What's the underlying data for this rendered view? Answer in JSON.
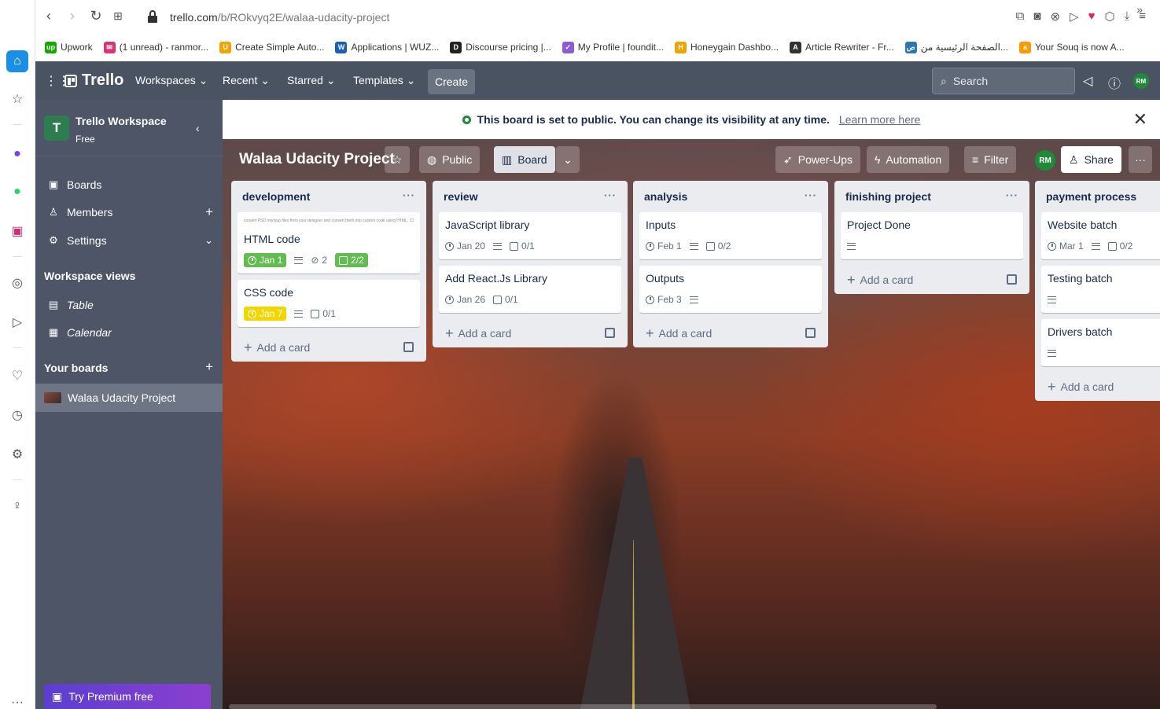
{
  "browser": {
    "url_host": "trello.com",
    "url_path": "/b/ROkvyq2E/walaa-udacity-project",
    "bookmarks": [
      {
        "label": "Upwork",
        "color": "#14a800",
        "glyph": "up"
      },
      {
        "label": "(1 unread) - ranmor...",
        "color": "#d93473",
        "glyph": "✉"
      },
      {
        "label": "Create Simple Auto...",
        "color": "#f0a400",
        "glyph": "U"
      },
      {
        "label": "Applications | WUZ...",
        "color": "#1a5fb4",
        "glyph": "W"
      },
      {
        "label": "Discourse pricing |...",
        "color": "#222222",
        "glyph": "D"
      },
      {
        "label": "My Profile | foundit...",
        "color": "#8a5cd6",
        "glyph": "✓"
      },
      {
        "label": "Honeygain Dashbo...",
        "color": "#f0a400",
        "glyph": "H"
      },
      {
        "label": "Article Rewriter - Fr...",
        "color": "#333333",
        "glyph": "A"
      },
      {
        "label": "الصفحة الرئيسية من...",
        "color": "#2a7ab0",
        "glyph": "ص"
      },
      {
        "label": "Your Souq is now A...",
        "color": "#ff9900",
        "glyph": "a"
      }
    ],
    "bookmarks_more": "»"
  },
  "header": {
    "logo": "Trello",
    "menus": [
      "Workspaces",
      "Recent",
      "Starred",
      "Templates"
    ],
    "create": "Create",
    "search_placeholder": "Search",
    "avatar": "RM"
  },
  "sidebar": {
    "workspace_initial": "T",
    "workspace_name": "Trello Workspace",
    "workspace_plan": "Free",
    "items": [
      {
        "label": "Boards",
        "icon": "board-icon"
      },
      {
        "label": "Members",
        "icon": "person-icon"
      },
      {
        "label": "Settings",
        "icon": "gear-icon"
      }
    ],
    "views_title": "Workspace views",
    "views": [
      {
        "label": "Table",
        "icon": "table-icon"
      },
      {
        "label": "Calendar",
        "icon": "calendar-icon"
      }
    ],
    "your_boards_title": "Your boards",
    "boards": [
      "Walaa Udacity Project"
    ],
    "premium": "Try Premium free"
  },
  "notice": {
    "text": "This board is set to public. You can change its visibility at any time.",
    "link": "Learn more here"
  },
  "board": {
    "title": "Walaa Udacity Project",
    "visibility": "Public",
    "view": "Board",
    "powerups": "Power-Ups",
    "automation": "Automation",
    "filter": "Filter",
    "member": "RM",
    "share": "Share"
  },
  "lists": [
    {
      "title": "development",
      "cards": [
        {
          "cover_text": "convert PSD mockup files from your designer and convert them into custom code using HTML, CSS, and JavaScript",
          "title": "HTML code",
          "due": "Jan 1",
          "due_style": "green",
          "desc": true,
          "attachments": "2",
          "checklist": "2/2",
          "checklist_style": "green"
        },
        {
          "title": "CSS code",
          "due": "Jan 7",
          "due_style": "yellow",
          "desc": true,
          "checklist": "0/1"
        }
      ],
      "add": "Add a card"
    },
    {
      "title": "review",
      "cards": [
        {
          "title": "JavaScript library",
          "due": "Jan 20",
          "desc": true,
          "checklist": "0/1"
        },
        {
          "title": "Add React.Js Library",
          "due": "Jan 26",
          "checklist": "0/1"
        }
      ],
      "add": "Add a card"
    },
    {
      "title": "analysis",
      "cards": [
        {
          "title": "Inputs",
          "due": "Feb 1",
          "desc": true,
          "checklist": "0/2"
        },
        {
          "title": "Outputs",
          "due": "Feb 3",
          "desc": true
        }
      ],
      "add": "Add a card"
    },
    {
      "title": "finishing project",
      "cards": [
        {
          "title": "Project Done",
          "desc": true
        }
      ],
      "add": "Add a card"
    },
    {
      "title": "payment process",
      "cards": [
        {
          "title": "Website batch",
          "due": "Mar 1",
          "desc": true,
          "checklist": "0/2"
        },
        {
          "title": "Testing batch",
          "desc": true
        },
        {
          "title": "Drivers batch",
          "desc": true
        }
      ],
      "add": "Add a card"
    }
  ]
}
